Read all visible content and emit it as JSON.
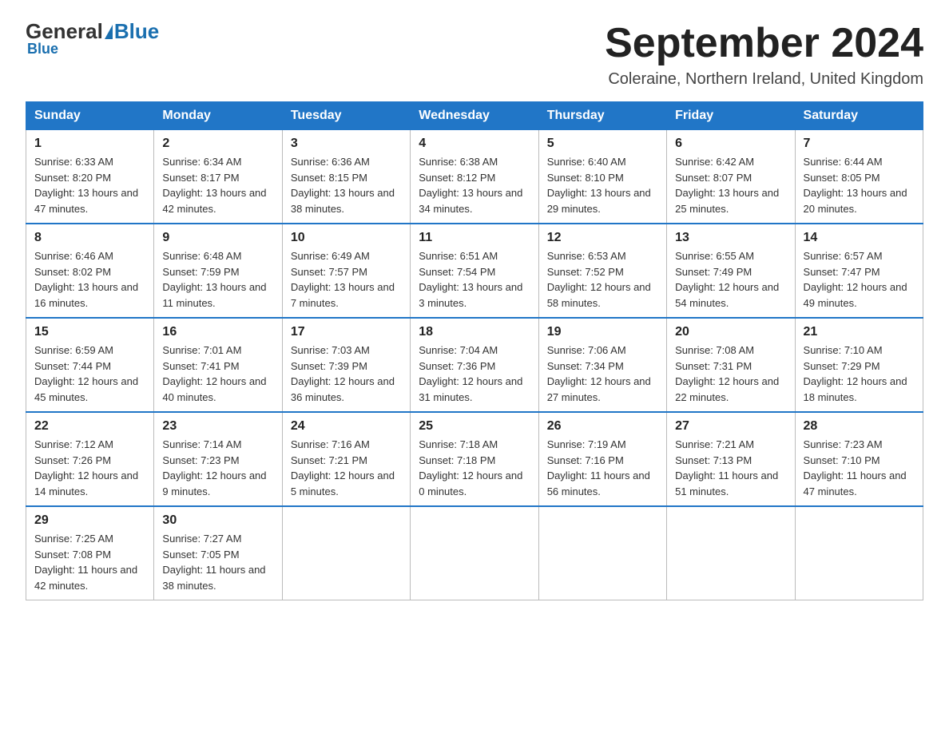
{
  "header": {
    "logo_general": "General",
    "logo_blue": "Blue",
    "month_title": "September 2024",
    "location": "Coleraine, Northern Ireland, United Kingdom"
  },
  "days_of_week": [
    "Sunday",
    "Monday",
    "Tuesday",
    "Wednesday",
    "Thursday",
    "Friday",
    "Saturday"
  ],
  "weeks": [
    [
      {
        "num": "1",
        "info": "Sunrise: 6:33 AM\nSunset: 8:20 PM\nDaylight: 13 hours and 47 minutes."
      },
      {
        "num": "2",
        "info": "Sunrise: 6:34 AM\nSunset: 8:17 PM\nDaylight: 13 hours and 42 minutes."
      },
      {
        "num": "3",
        "info": "Sunrise: 6:36 AM\nSunset: 8:15 PM\nDaylight: 13 hours and 38 minutes."
      },
      {
        "num": "4",
        "info": "Sunrise: 6:38 AM\nSunset: 8:12 PM\nDaylight: 13 hours and 34 minutes."
      },
      {
        "num": "5",
        "info": "Sunrise: 6:40 AM\nSunset: 8:10 PM\nDaylight: 13 hours and 29 minutes."
      },
      {
        "num": "6",
        "info": "Sunrise: 6:42 AM\nSunset: 8:07 PM\nDaylight: 13 hours and 25 minutes."
      },
      {
        "num": "7",
        "info": "Sunrise: 6:44 AM\nSunset: 8:05 PM\nDaylight: 13 hours and 20 minutes."
      }
    ],
    [
      {
        "num": "8",
        "info": "Sunrise: 6:46 AM\nSunset: 8:02 PM\nDaylight: 13 hours and 16 minutes."
      },
      {
        "num": "9",
        "info": "Sunrise: 6:48 AM\nSunset: 7:59 PM\nDaylight: 13 hours and 11 minutes."
      },
      {
        "num": "10",
        "info": "Sunrise: 6:49 AM\nSunset: 7:57 PM\nDaylight: 13 hours and 7 minutes."
      },
      {
        "num": "11",
        "info": "Sunrise: 6:51 AM\nSunset: 7:54 PM\nDaylight: 13 hours and 3 minutes."
      },
      {
        "num": "12",
        "info": "Sunrise: 6:53 AM\nSunset: 7:52 PM\nDaylight: 12 hours and 58 minutes."
      },
      {
        "num": "13",
        "info": "Sunrise: 6:55 AM\nSunset: 7:49 PM\nDaylight: 12 hours and 54 minutes."
      },
      {
        "num": "14",
        "info": "Sunrise: 6:57 AM\nSunset: 7:47 PM\nDaylight: 12 hours and 49 minutes."
      }
    ],
    [
      {
        "num": "15",
        "info": "Sunrise: 6:59 AM\nSunset: 7:44 PM\nDaylight: 12 hours and 45 minutes."
      },
      {
        "num": "16",
        "info": "Sunrise: 7:01 AM\nSunset: 7:41 PM\nDaylight: 12 hours and 40 minutes."
      },
      {
        "num": "17",
        "info": "Sunrise: 7:03 AM\nSunset: 7:39 PM\nDaylight: 12 hours and 36 minutes."
      },
      {
        "num": "18",
        "info": "Sunrise: 7:04 AM\nSunset: 7:36 PM\nDaylight: 12 hours and 31 minutes."
      },
      {
        "num": "19",
        "info": "Sunrise: 7:06 AM\nSunset: 7:34 PM\nDaylight: 12 hours and 27 minutes."
      },
      {
        "num": "20",
        "info": "Sunrise: 7:08 AM\nSunset: 7:31 PM\nDaylight: 12 hours and 22 minutes."
      },
      {
        "num": "21",
        "info": "Sunrise: 7:10 AM\nSunset: 7:29 PM\nDaylight: 12 hours and 18 minutes."
      }
    ],
    [
      {
        "num": "22",
        "info": "Sunrise: 7:12 AM\nSunset: 7:26 PM\nDaylight: 12 hours and 14 minutes."
      },
      {
        "num": "23",
        "info": "Sunrise: 7:14 AM\nSunset: 7:23 PM\nDaylight: 12 hours and 9 minutes."
      },
      {
        "num": "24",
        "info": "Sunrise: 7:16 AM\nSunset: 7:21 PM\nDaylight: 12 hours and 5 minutes."
      },
      {
        "num": "25",
        "info": "Sunrise: 7:18 AM\nSunset: 7:18 PM\nDaylight: 12 hours and 0 minutes."
      },
      {
        "num": "26",
        "info": "Sunrise: 7:19 AM\nSunset: 7:16 PM\nDaylight: 11 hours and 56 minutes."
      },
      {
        "num": "27",
        "info": "Sunrise: 7:21 AM\nSunset: 7:13 PM\nDaylight: 11 hours and 51 minutes."
      },
      {
        "num": "28",
        "info": "Sunrise: 7:23 AM\nSunset: 7:10 PM\nDaylight: 11 hours and 47 minutes."
      }
    ],
    [
      {
        "num": "29",
        "info": "Sunrise: 7:25 AM\nSunset: 7:08 PM\nDaylight: 11 hours and 42 minutes."
      },
      {
        "num": "30",
        "info": "Sunrise: 7:27 AM\nSunset: 7:05 PM\nDaylight: 11 hours and 38 minutes."
      },
      null,
      null,
      null,
      null,
      null
    ]
  ]
}
